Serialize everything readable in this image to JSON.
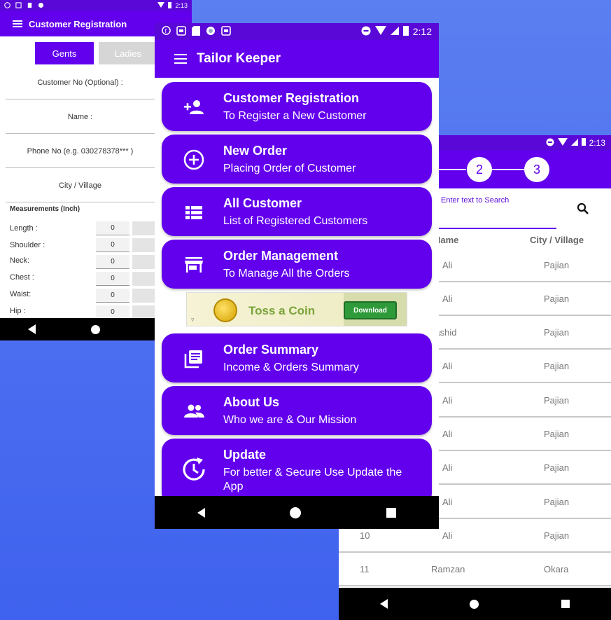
{
  "colors": {
    "primary": "#6200ee",
    "status_bar": "#5a08d8",
    "background": "#4a6cf0"
  },
  "phone_left": {
    "status": {
      "time": "2:13"
    },
    "title": "Customer Registration",
    "tabs": [
      "Gents",
      "Ladies"
    ],
    "fields": [
      "Customer No (Optional) :",
      "Name :",
      "Phone No (e.g. 030278378*** )",
      "City / Village"
    ],
    "measurements_title": "Measurements (Inch)",
    "measurements": [
      {
        "label": "Length :",
        "value": "0"
      },
      {
        "label": "Shoulder :",
        "value": "0"
      },
      {
        "label": "Neck:",
        "value": "0"
      },
      {
        "label": "Chest :",
        "value": "0"
      },
      {
        "label": "Waist:",
        "value": "0"
      },
      {
        "label": "Hip :",
        "value": "0"
      }
    ]
  },
  "phone_center": {
    "status": {
      "time": "2:12"
    },
    "title": "Tailor Keeper",
    "menu": [
      {
        "title": "Customer Registration",
        "subtitle": "To Register a New Customer",
        "icon": "person-add-icon"
      },
      {
        "title": "New Order",
        "subtitle": "Placing Order of Customer",
        "icon": "add-circle-icon"
      },
      {
        "title": "All Customer",
        "subtitle": "List of Registered Customers",
        "icon": "list-icon"
      },
      {
        "title": "Order Management",
        "subtitle": "To Manage All the Orders",
        "icon": "store-icon"
      },
      {
        "title": "Order Summary",
        "subtitle": "Income & Orders Summary",
        "icon": "summary-icon"
      },
      {
        "title": "About Us",
        "subtitle": "Who we are & Our Mission",
        "icon": "people-icon"
      },
      {
        "title": "Update",
        "subtitle": "For better & Secure Use Update the App",
        "icon": "update-icon"
      }
    ],
    "ad": {
      "title": "Toss a Coin",
      "button": "Download"
    }
  },
  "phone_right": {
    "status": {
      "time": "2:13"
    },
    "steps": [
      "2",
      "3"
    ],
    "search_placeholder": "Enter text to Search",
    "columns": [
      "Name",
      "City / Village"
    ],
    "rows": [
      {
        "no": "",
        "name": "Ali",
        "city": "Pajian"
      },
      {
        "no": "",
        "name": "Ali",
        "city": "Pajian"
      },
      {
        "no": "",
        "name": "Rashid",
        "city": "Pajian"
      },
      {
        "no": "",
        "name": "Ali",
        "city": "Pajian"
      },
      {
        "no": "",
        "name": "Ali",
        "city": "Pajian"
      },
      {
        "no": "",
        "name": "Ali",
        "city": "Pajian"
      },
      {
        "no": "",
        "name": "Ali",
        "city": "Pajian"
      },
      {
        "no": "",
        "name": "Ali",
        "city": "Pajian"
      },
      {
        "no": "10",
        "name": "Ali",
        "city": "Pajian"
      },
      {
        "no": "11",
        "name": "Ramzan",
        "city": "Okara"
      }
    ]
  }
}
